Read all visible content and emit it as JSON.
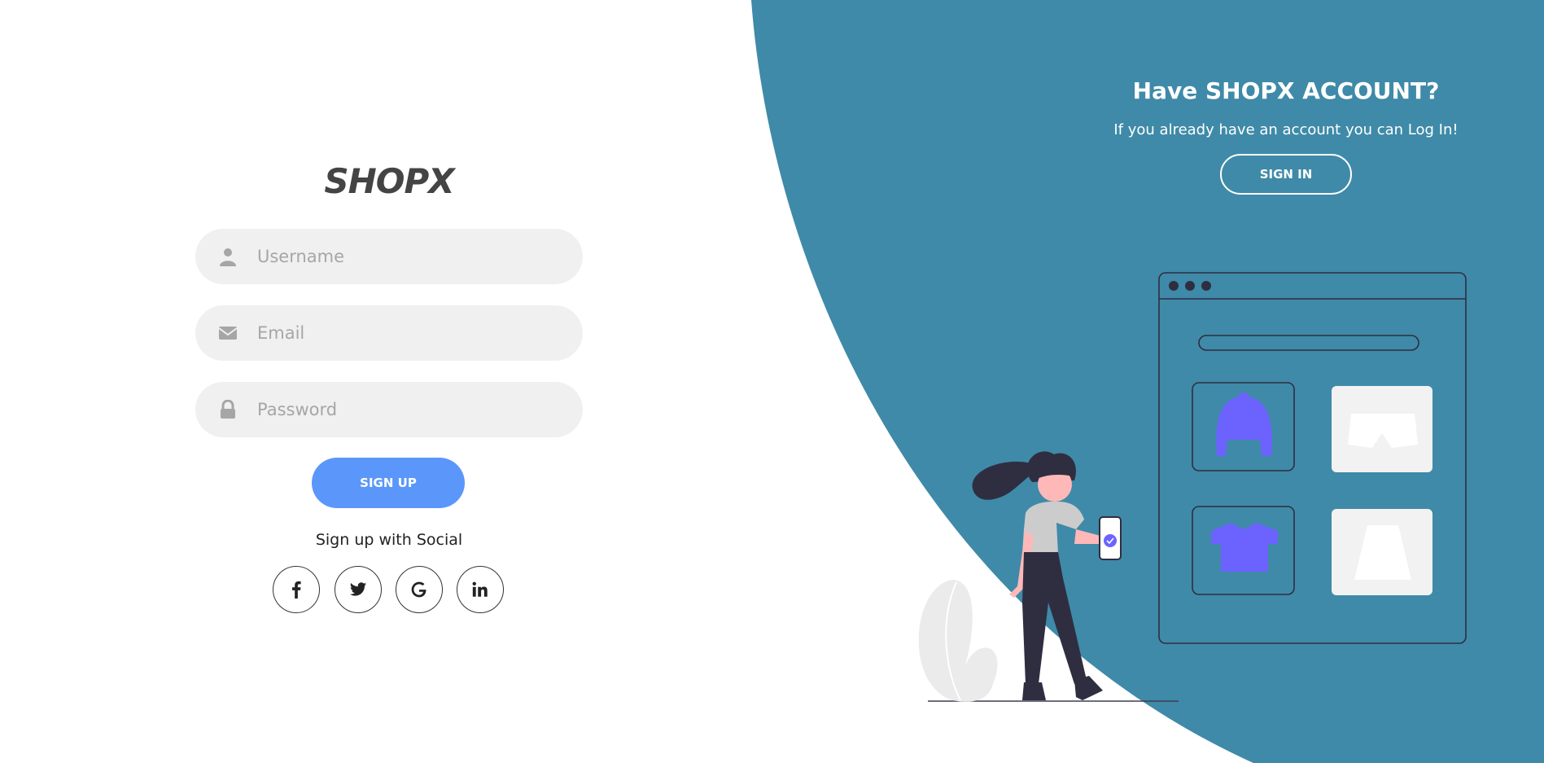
{
  "brand": {
    "logo_text": "SHOPX"
  },
  "signup_form": {
    "username": {
      "placeholder": "Username",
      "icon": "user-icon"
    },
    "email": {
      "placeholder": "Email",
      "icon": "envelope-icon"
    },
    "password": {
      "placeholder": "Password",
      "icon": "lock-icon"
    },
    "submit_label": "SIGN UP",
    "social_label": "Sign up with Social",
    "social_buttons": [
      {
        "icon": "facebook-icon"
      },
      {
        "icon": "twitter-icon"
      },
      {
        "icon": "google-icon"
      },
      {
        "icon": "linkedin-icon"
      }
    ]
  },
  "signin_panel": {
    "title": "Have SHOPX ACCOUNT?",
    "subtitle": "If you already have an account you can Log In!",
    "button_label": "SIGN IN"
  },
  "colors": {
    "panel_background": "#3f8aa8",
    "signup_button": "#5b97fa",
    "input_background": "#f0f0f0",
    "illustration_accent": "#6c63ff"
  }
}
